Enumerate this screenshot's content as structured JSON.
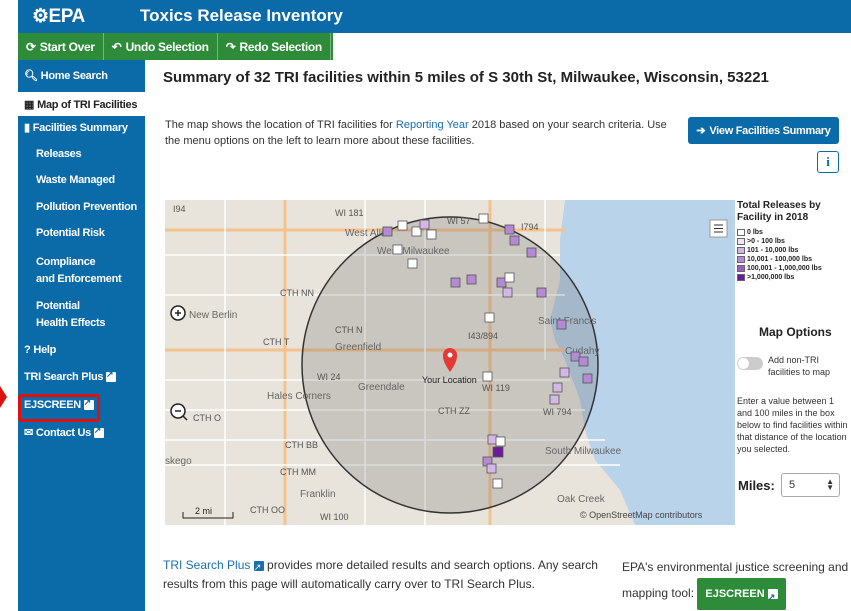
{
  "header": {
    "logo": "EPA",
    "title": "Toxics Release Inventory"
  },
  "toolbar": {
    "start_over": "Start Over",
    "undo": "Undo Selection",
    "redo": "Redo Selection"
  },
  "sidebar": {
    "items": [
      {
        "label": "Home Search",
        "icon": "search-icon"
      },
      {
        "label": "Map of TRI Facilities",
        "icon": "map-icon"
      },
      {
        "label": "Facilities Summary",
        "icon": "bar-chart-icon"
      },
      {
        "label": "Releases"
      },
      {
        "label": "Waste Managed"
      },
      {
        "label": "Pollution Prevention"
      },
      {
        "label": "Potential Risk"
      },
      {
        "label": "Compliance\nand Enforcement"
      },
      {
        "label": "Potential\nHealth Effects"
      },
      {
        "label": "Help",
        "icon": "question-icon"
      },
      {
        "label": "TRI Search Plus",
        "icon": "external-link-icon"
      },
      {
        "label": "EJSCREEN",
        "icon": "external-link-icon"
      },
      {
        "label": "Contact Us",
        "icon": "envelope-icon"
      }
    ]
  },
  "main": {
    "heading": "Summary of 32 TRI facilities within 5 miles of S 30th St, Milwaukee, Wisconsin, 53221",
    "intro_part1": "The map shows the location of TRI facilities for ",
    "intro_link": "Reporting Year",
    "intro_part2": " 2018 based on your search criteria. Use the menu options on the left to learn more about these facilities.",
    "view_button": "View Facilities Summary",
    "info_button": "i"
  },
  "map": {
    "labels": [
      "WI 181",
      "West Allis",
      "West Milwaukee",
      "WI 57",
      "I794",
      "CTH NN",
      "New Berlin",
      "CTH N",
      "CTH T",
      "Greenfield",
      "I43/894",
      "Saint Francis",
      "Cudahy",
      "WI 24",
      "Your Location",
      "Greendale",
      "WI 119",
      "Hales Corners",
      "CTH O",
      "CTH ZZ",
      "WI 794",
      "CTH BB",
      "South Milwaukee",
      "skego",
      "CTH MM",
      "Franklin",
      "Oak Creek",
      "CTH OO",
      "WI 100",
      "I94"
    ],
    "scale": "2 mi",
    "attribution": "© OpenStreetMap contributors"
  },
  "legend": {
    "title": "Total Releases by Facility in 2018",
    "items": [
      {
        "label": "0 lbs",
        "color": "#ffffff"
      },
      {
        "label": ">0 - 100 lbs",
        "color": "#f0e6f6"
      },
      {
        "label": "101 - 10,000 lbs",
        "color": "#d3b7e6"
      },
      {
        "label": "10,001 - 100,000 lbs",
        "color": "#b48ad3"
      },
      {
        "label": "100,001 - 1,000,000 lbs",
        "color": "#9a5fc2"
      },
      {
        "label": ">1,000,000 lbs",
        "color": "#6a1b9a"
      }
    ]
  },
  "map_options": {
    "title": "Map Options",
    "toggle_label": "Add non-TRI facilities to map",
    "help": "Enter a value between 1 and 100 miles in the box below to find facilities within that distance of the location you selected.",
    "miles_label": "Miles:",
    "miles_value": "5"
  },
  "footer": {
    "left_link": "TRI Search Plus",
    "left_text": " provides more detailed results and search options. Any search results from this page will automatically carry over to TRI Search Plus.",
    "right_text": "EPA's environmental justice screening and mapping tool:",
    "ej_button": "EJSCREEN"
  },
  "colors": {
    "epa_blue": "#0b6aa8",
    "toolbar_green": "#2e8b3a",
    "highlight_red": "#e01010",
    "marker_red": "#e53935"
  }
}
